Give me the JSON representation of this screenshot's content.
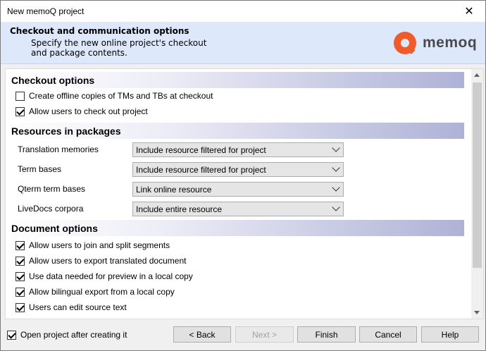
{
  "window": {
    "title": "New memoQ project"
  },
  "header": {
    "title": "Checkout and communication options",
    "subtitle": "Specify the new online project's checkout and package contents.",
    "logo_text": "memoq",
    "accent": "#f15a2b"
  },
  "checkout": {
    "heading": "Checkout options",
    "items": [
      {
        "label": "Create offline copies of TMs and TBs at checkout",
        "checked": false
      },
      {
        "label": "Allow users to check out project",
        "checked": true
      }
    ]
  },
  "resources": {
    "heading": "Resources in packages",
    "rows": [
      {
        "label": "Translation memories",
        "value": "Include resource filtered for project"
      },
      {
        "label": "Term bases",
        "value": "Include resource filtered for project"
      },
      {
        "label": "Qterm term bases",
        "value": "Link online resource"
      },
      {
        "label": "LiveDocs corpora",
        "value": "Include entire resource"
      }
    ]
  },
  "document": {
    "heading": "Document options",
    "items": [
      {
        "label": "Allow users to join and split segments",
        "checked": true
      },
      {
        "label": "Allow users to export translated document",
        "checked": true
      },
      {
        "label": "Use data needed for preview in a local copy",
        "checked": true
      },
      {
        "label": "Allow bilingual export from a local copy",
        "checked": true
      },
      {
        "label": "Users can edit source text",
        "checked": true
      }
    ]
  },
  "footer": {
    "open_project_label": "Open project after creating it",
    "open_project_checked": true,
    "back": "< Back",
    "next": "Next >",
    "finish": "Finish",
    "cancel": "Cancel",
    "help": "Help"
  }
}
